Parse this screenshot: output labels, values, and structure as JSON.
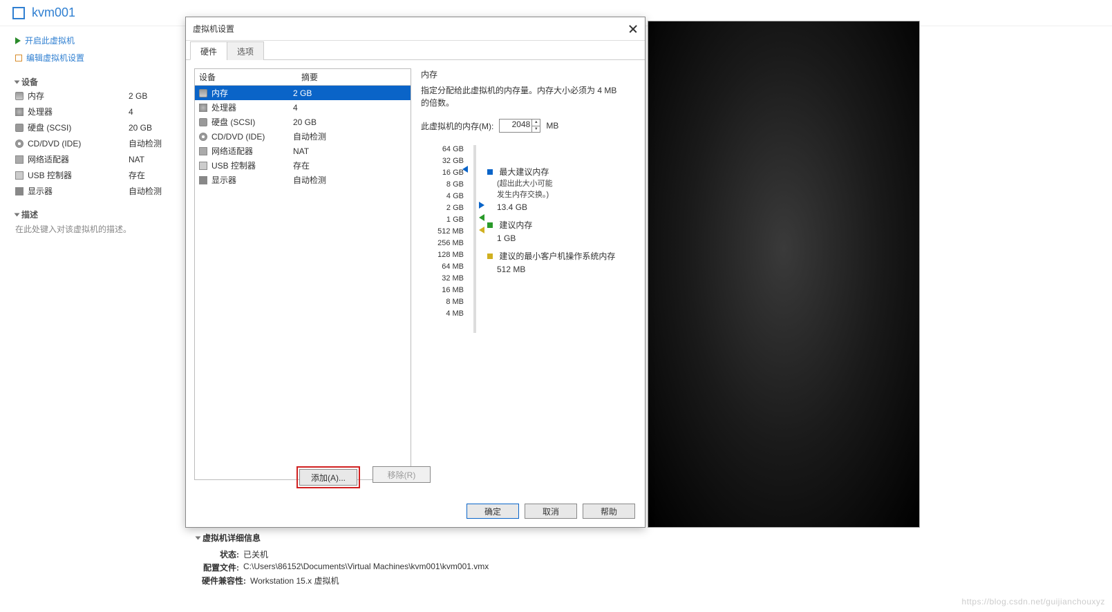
{
  "header": {
    "vm_name": "kvm001"
  },
  "actions": {
    "power_on": "开启此虚拟机",
    "edit_settings": "编辑虚拟机设置"
  },
  "sections": {
    "devices": "设备",
    "description": "描述"
  },
  "devices": [
    {
      "name": "内存",
      "value": "2 GB",
      "icon": "ram"
    },
    {
      "name": "处理器",
      "value": "4",
      "icon": "cpu"
    },
    {
      "name": "硬盘 (SCSI)",
      "value": "20 GB",
      "icon": "hdd"
    },
    {
      "name": "CD/DVD (IDE)",
      "value": "自动检测",
      "icon": "cd"
    },
    {
      "name": "网络适配器",
      "value": "NAT",
      "icon": "net"
    },
    {
      "name": "USB 控制器",
      "value": "存在",
      "icon": "usb"
    },
    {
      "name": "显示器",
      "value": "自动检测",
      "icon": "disp"
    }
  ],
  "description_placeholder": "在此处键入对该虚拟机的描述。",
  "dialog": {
    "title": "虚拟机设置",
    "tabs": {
      "hardware": "硬件",
      "options": "选项"
    },
    "columns": {
      "device": "设备",
      "summary": "摘要"
    },
    "hw_rows": [
      {
        "name": "内存",
        "value": "2 GB",
        "icon": "ram",
        "selected": true
      },
      {
        "name": "处理器",
        "value": "4",
        "icon": "cpu"
      },
      {
        "name": "硬盘 (SCSI)",
        "value": "20 GB",
        "icon": "hdd"
      },
      {
        "name": "CD/DVD (IDE)",
        "value": "自动检测",
        "icon": "cd"
      },
      {
        "name": "网络适配器",
        "value": "NAT",
        "icon": "net"
      },
      {
        "name": "USB 控制器",
        "value": "存在",
        "icon": "usb"
      },
      {
        "name": "显示器",
        "value": "自动检测",
        "icon": "disp"
      }
    ],
    "memory": {
      "title": "内存",
      "desc": "指定分配给此虚拟机的内存量。内存大小必须为 4 MB 的倍数。",
      "input_label": "此虚拟机的内存(M):",
      "value": "2048",
      "unit": "MB",
      "scale": [
        "64 GB",
        "32 GB",
        "16 GB",
        "8 GB",
        "4 GB",
        "2 GB",
        "1 GB",
        "512 MB",
        "256 MB",
        "128 MB",
        "64 MB",
        "32 MB",
        "16 MB",
        "8 MB",
        "4 MB"
      ],
      "legend": {
        "max": {
          "label": "最大建议内存",
          "note1": "(超出此大小可能",
          "note2": "发生内存交换。)",
          "value": "13.4 GB"
        },
        "rec": {
          "label": "建议内存",
          "value": "1 GB"
        },
        "min": {
          "label": "建议的最小客户机操作系统内存",
          "value": "512 MB"
        }
      }
    },
    "buttons": {
      "add": "添加(A)...",
      "remove": "移除(R)",
      "ok": "确定",
      "cancel": "取消",
      "help": "帮助"
    }
  },
  "vm_details": {
    "header": "虚拟机详细信息",
    "rows": {
      "status_k": "状态:",
      "status_v": "已关机",
      "config_k": "配置文件:",
      "config_v": "C:\\Users\\86152\\Documents\\Virtual Machines\\kvm001\\kvm001.vmx",
      "compat_k": "硬件兼容性:",
      "compat_v": "Workstation 15.x 虚拟机"
    }
  },
  "watermark": "https://blog.csdn.net/guijianchouxyz"
}
